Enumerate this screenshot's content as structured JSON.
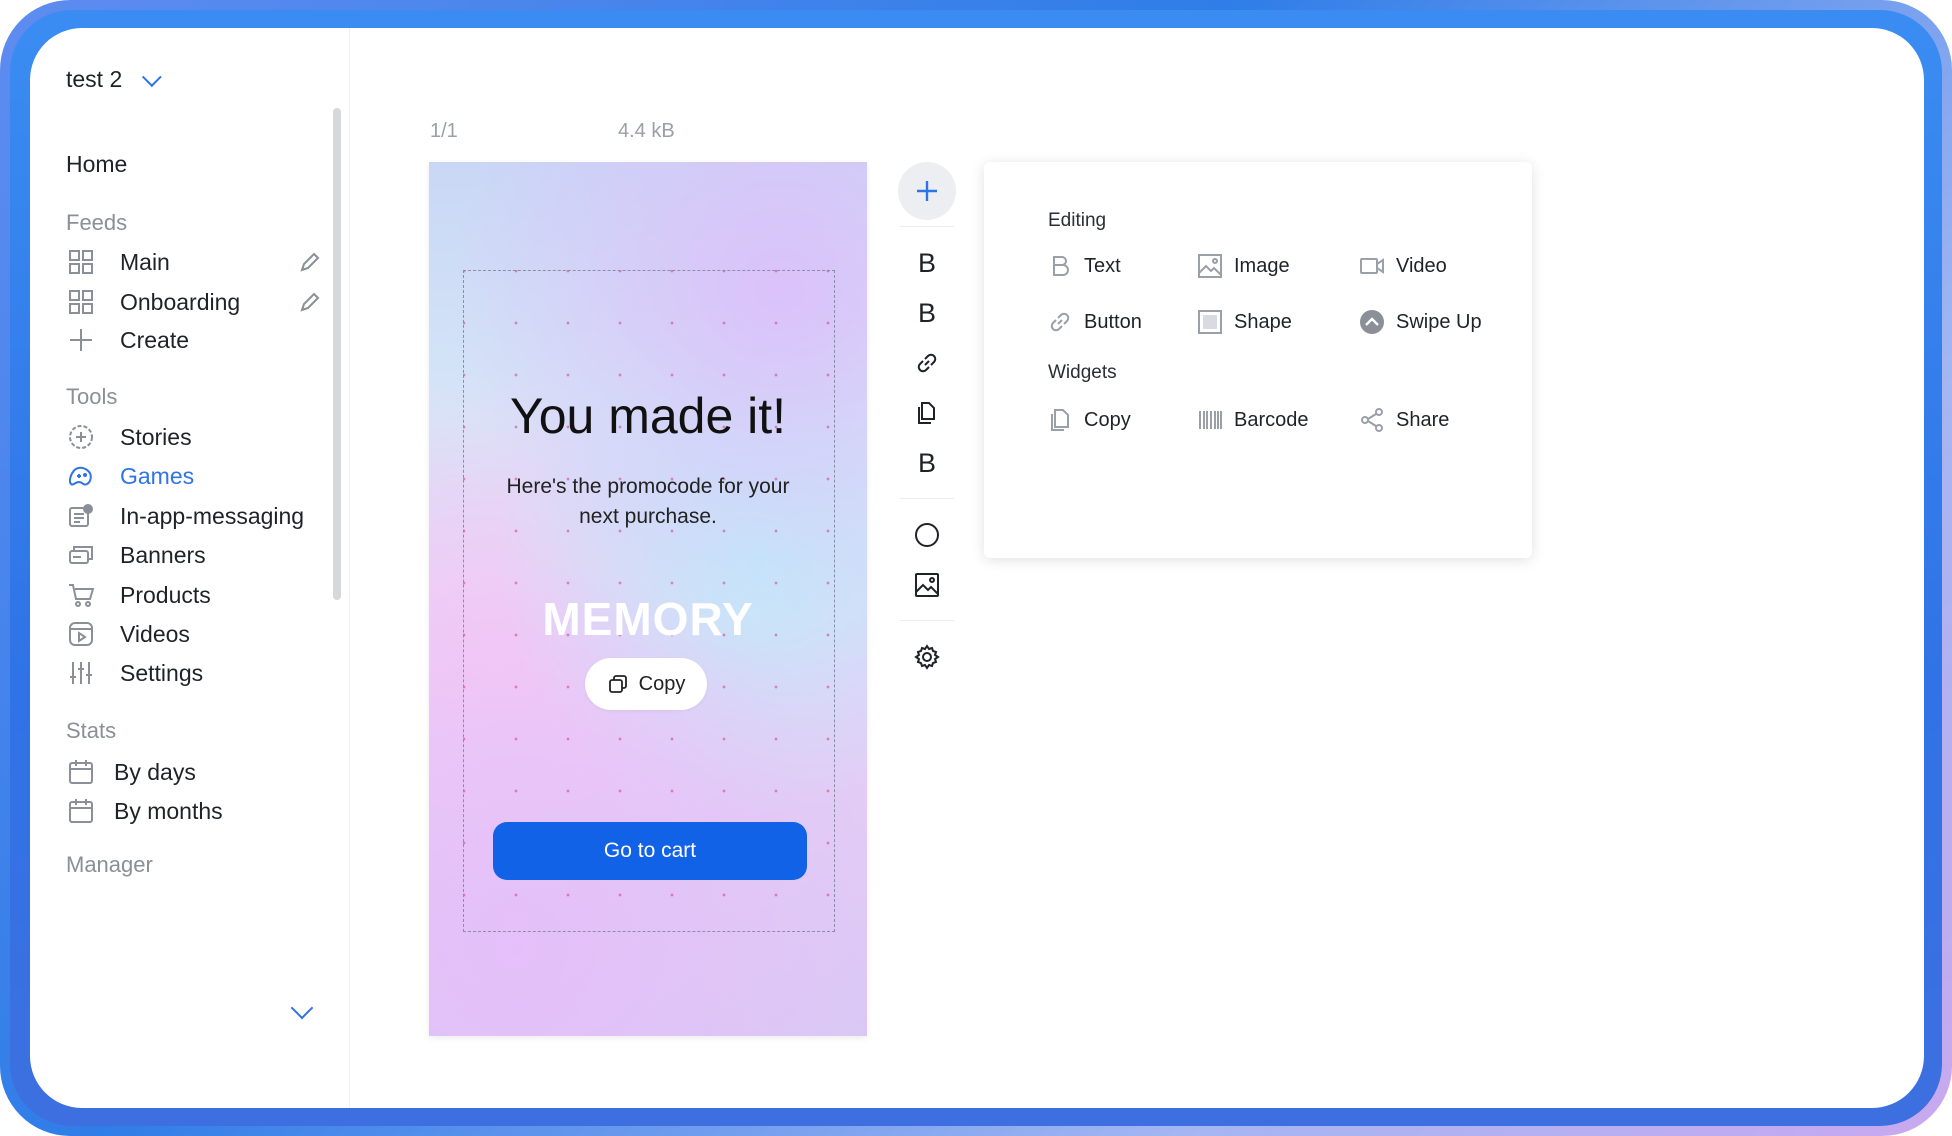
{
  "workspace": {
    "name": "test 2"
  },
  "nav": {
    "home": "Home",
    "feeds_header": "Feeds",
    "feeds": [
      {
        "label": "Main",
        "icon": "grid-icon"
      },
      {
        "label": "Onboarding",
        "icon": "grid-icon"
      },
      {
        "label": "Create",
        "icon": "plus-icon"
      }
    ],
    "tools_header": "Tools",
    "tools": [
      {
        "label": "Stories",
        "icon": "stories-icon"
      },
      {
        "label": "Games",
        "icon": "gamepad-icon",
        "active": true
      },
      {
        "label": "In-app-messaging",
        "icon": "message-icon"
      },
      {
        "label": "Banners",
        "icon": "banner-icon"
      },
      {
        "label": "Products",
        "icon": "cart-icon"
      },
      {
        "label": "Videos",
        "icon": "video-icon"
      },
      {
        "label": "Settings",
        "icon": "sliders-icon"
      }
    ],
    "stats_header": "Stats",
    "stats": [
      {
        "label": "By days",
        "icon": "calendar-icon"
      },
      {
        "label": "By months",
        "icon": "calendar-icon"
      }
    ],
    "manager_header": "Manager"
  },
  "editor": {
    "page_counter": "1/1",
    "file_size": "4.4 kB"
  },
  "preview": {
    "title": "You made it!",
    "subtitle": "Here's the promocode for your next purchase.",
    "promo_code": "MEMORY",
    "copy_label": "Copy",
    "cta_label": "Go to cart"
  },
  "toolbar": {
    "items": [
      "add-icon",
      "text-icon",
      "text-icon",
      "link-icon",
      "copy-icon",
      "text-icon",
      "circle-icon",
      "image-icon",
      "settings-icon"
    ],
    "text_glyph": "B"
  },
  "popover": {
    "editing_header": "Editing",
    "editing": [
      "Text",
      "Image",
      "Video",
      "Button",
      "Shape",
      "Swipe Up"
    ],
    "widgets_header": "Widgets",
    "widgets": [
      "Copy",
      "Barcode",
      "Share"
    ]
  },
  "colors": {
    "accent": "#2f74e6",
    "cta": "#1162e6",
    "frame": "#2f73e6"
  }
}
